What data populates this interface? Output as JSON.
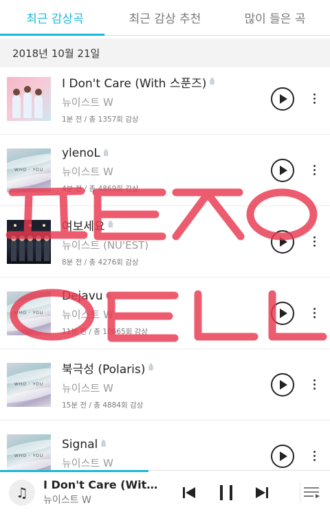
{
  "tabs": [
    {
      "label": "최근 감상곡",
      "active": true
    },
    {
      "label": "최근 감상 추천",
      "active": false
    },
    {
      "label": "많이 들은 곡",
      "active": false
    }
  ],
  "date_header": "2018년 10월 21일",
  "songs": [
    {
      "title": "I Don't Care (With 스푼즈)",
      "artist": "뉴이스트 W",
      "meta": "1분 전 / 총 1357회 감상",
      "cover": "pink"
    },
    {
      "title": "ylenoL",
      "artist": "뉴이스트 W",
      "meta": "4분 전 / 총 4869회 감상",
      "cover": "wave"
    },
    {
      "title": "여보세요",
      "artist": "뉴이스트 (NU'EST)",
      "meta": "8분 전 / 총 4276회 감상",
      "cover": "dark"
    },
    {
      "title": "Dejavu",
      "artist": "뉴이스트 W",
      "meta": "11분 전 / 총 10665회 감상",
      "cover": "wave"
    },
    {
      "title": "북극성 (Polaris)",
      "artist": "뉴이스트 W",
      "meta": "15분 전 / 총 4884회 감상",
      "cover": "wave"
    },
    {
      "title": "Signal",
      "artist": "뉴이스트 W",
      "meta": "",
      "cover": "wave"
    }
  ],
  "now_playing": {
    "title": "I Don't Care (With...",
    "artist": "뉴이스트 W",
    "progress_fraction": 0.45
  },
  "watermark": {
    "line1": "ㅍㅌㅈㅇ",
    "line2": "ㅇㅌㄴㄴ",
    "color": "#e8384f"
  },
  "colors": {
    "accent": "#19b8d8",
    "header_bg": "#f3f3f3"
  },
  "icons": {
    "hd": "hd-quality-icon",
    "play": "play-icon",
    "more": "more-vert-icon",
    "note": "music-note-icon",
    "prev": "skip-previous-icon",
    "pause": "pause-icon",
    "next": "skip-next-icon",
    "queue": "queue-icon"
  }
}
